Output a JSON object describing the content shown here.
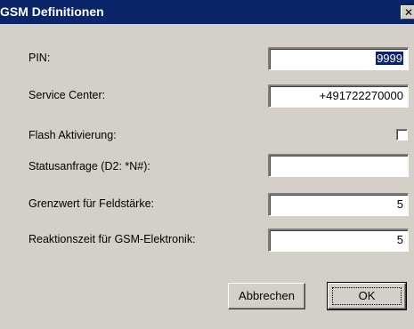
{
  "dialog": {
    "title": "GSM Definitionen",
    "close_glyph": "✕"
  },
  "fields": {
    "pin": {
      "label": "PIN:",
      "value": "9999"
    },
    "service_center": {
      "label": "Service Center:",
      "value": "+491722270000"
    },
    "flash": {
      "label": "Flash Aktivierung:",
      "checked": false
    },
    "status_request": {
      "label": "Statusanfrage (D2: *N#):",
      "value": ""
    },
    "field_strength": {
      "label": "Grenzwert für Feldstärke:",
      "value": "5"
    },
    "reaction_time": {
      "label": "Reaktionszeit für GSM-Elektronik:",
      "value": "5"
    }
  },
  "buttons": {
    "cancel": "Abbrechen",
    "ok": "OK"
  },
  "colors": {
    "titlebar": "#0a246a",
    "dialog_face": "#d4d0c8",
    "selection": "#0a246a"
  },
  "icons": {
    "close": "close-icon"
  }
}
